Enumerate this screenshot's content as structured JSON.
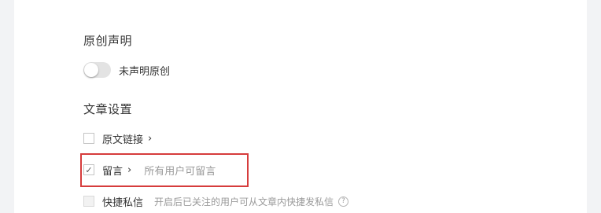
{
  "original": {
    "title": "原创声明",
    "toggle_label": "未声明原创",
    "toggle_on": false
  },
  "article_settings": {
    "title": "文章设置",
    "items": [
      {
        "label": "原文链接",
        "chevron": "›",
        "checked": false,
        "hint": ""
      },
      {
        "label": "留言",
        "chevron": "›",
        "checked": true,
        "hint": "所有用户可留言"
      },
      {
        "label": "快捷私信",
        "chevron": "",
        "checked": false,
        "hint": "开启后已关注的用户可从文章内快捷发私信",
        "help": "?"
      }
    ]
  },
  "colors": {
    "highlight": "#d63c3c",
    "panel": "#ffffff",
    "background": "#f2f3f5"
  },
  "icons": {
    "check": "✓"
  }
}
